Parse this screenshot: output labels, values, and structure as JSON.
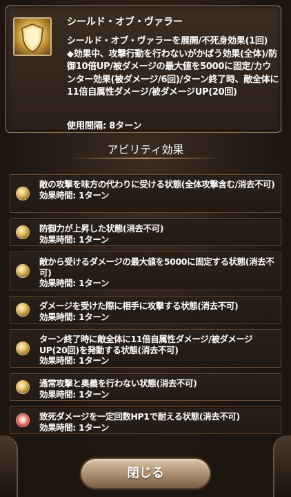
{
  "skill": {
    "title": "シールド・オブ・ヴァラー",
    "description": "シールド・オブ・ヴァラーを展開/不死身効果(1回)　◆効果中、攻撃行動を行わないがかばう効果(全体)/防御10倍UP/被ダメージの最大値を5000に固定/カウンター効果(被ダメージ/6回)/ターン終了時、敵全体に11倍自属性ダメージ/被ダメージUP(20回)",
    "cooldown_label": "使用間隔:",
    "cooldown_value": "8ターン",
    "icon": "shield-icon"
  },
  "section_title": "アビリティ効果",
  "effects": [
    {
      "text": "敵の攻撃を味方の代わりに受ける状態(全体攻撃含む/消去不可)",
      "duration": "効果時間: 1ターン",
      "icon": "shield-buff-icon"
    },
    {
      "text": "防御力が上昇した状態(消去不可)",
      "duration": "効果時間: 1ターン",
      "icon": "shield-buff-icon"
    },
    {
      "text": "敵から受けるダメージの最大値を5000に固定する状態(消去不可)",
      "duration": "効果時間: 1ターン",
      "icon": "shield-buff-icon"
    },
    {
      "text": "ダメージを受けた際に相手に攻撃する状態(消去不可)",
      "duration": "効果時間: 1ターン",
      "icon": "shield-buff-icon"
    },
    {
      "text": "ターン終了時に敵全体に11倍自属性ダメージ/被ダメージUP(20回)を発動する状態(消去不可)",
      "duration": "効果時間: 1ターン",
      "icon": "shield-buff-icon"
    },
    {
      "text": "通常攻撃と奥義を行わない状態(消去不可)",
      "duration": "効果時間: 1ターン",
      "icon": "shield-buff-icon"
    },
    {
      "text": "致死ダメージを一定回数HP1で耐える状態(消去不可)",
      "duration": "効果時間: 1ターン",
      "icon": "skull-buff-icon"
    }
  ],
  "close_label": "閉じる",
  "colors": {
    "panel_bg": "#2b2019",
    "border": "#a08260",
    "effect_border": "#6b4d34",
    "button": "#b29677"
  }
}
